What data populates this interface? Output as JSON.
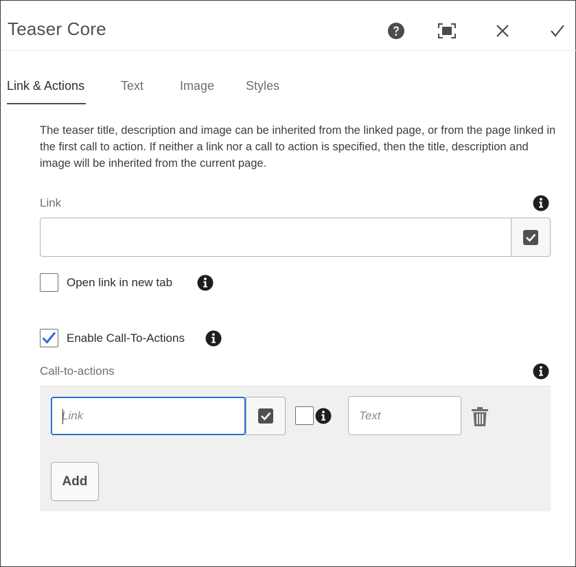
{
  "dialog": {
    "title": "Teaser Core",
    "header_icons": [
      "help-icon",
      "fullscreen-icon",
      "close-icon",
      "checkmark-icon"
    ]
  },
  "tabs": [
    {
      "label": "Link & Actions",
      "active": true
    },
    {
      "label": "Text",
      "active": false
    },
    {
      "label": "Image",
      "active": false
    },
    {
      "label": "Styles",
      "active": false
    }
  ],
  "intro": "The teaser title, description and image can be inherited from the linked page, or from the page linked in the first call to action. If neither a link nor a call to action is specified, then the title, description and image will be inherited from the current page.",
  "link": {
    "label": "Link",
    "value": "",
    "placeholder": ""
  },
  "open_new_tab": {
    "label": "Open link in new tab",
    "checked": false
  },
  "enable_cta": {
    "label": "Enable Call-To-Actions",
    "checked": true
  },
  "cta": {
    "label": "Call-to-actions",
    "items": [
      {
        "link_placeholder": "Link",
        "text_placeholder": "Text",
        "new_tab_checked": false
      }
    ],
    "add_label": "Add"
  },
  "colors": {
    "focus_border": "#2d6dd4",
    "checkbox_check": "#2d6dd4",
    "panel_bg": "#f0f0f0"
  }
}
